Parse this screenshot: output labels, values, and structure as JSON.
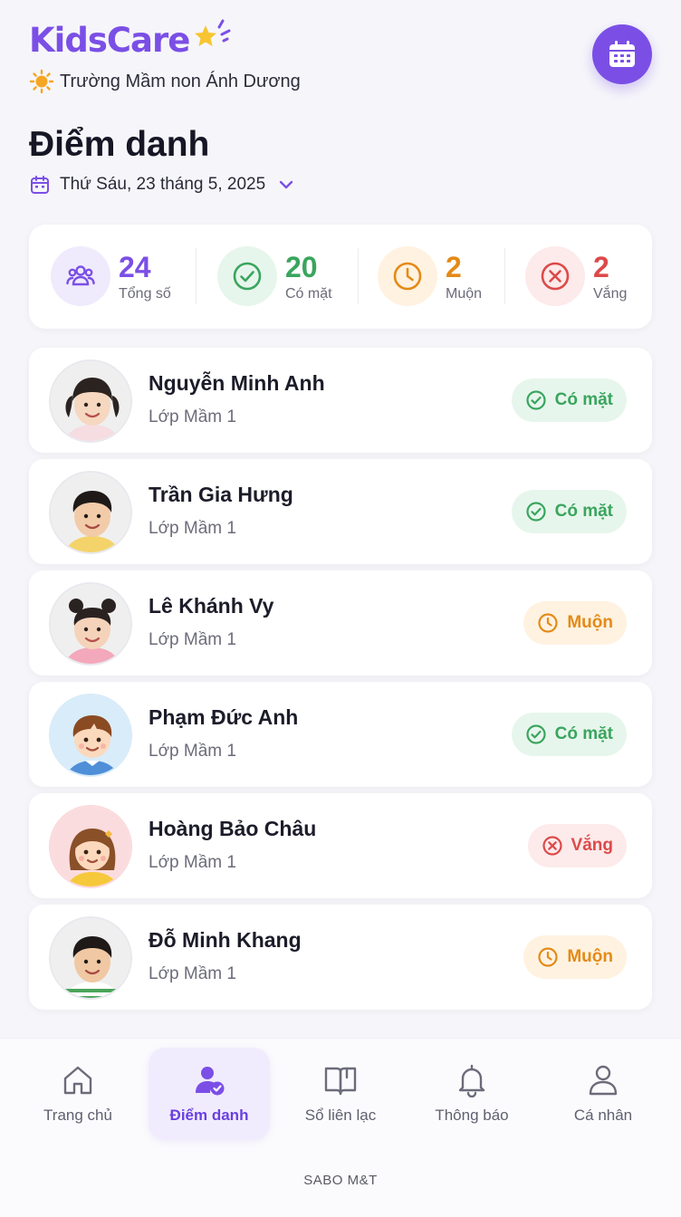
{
  "app": {
    "logo_text": "KidsCare",
    "school_name": "Trường Mầm non Ánh Dương"
  },
  "page": {
    "title": "Điểm danh",
    "date": "Thứ Sáu, 23 tháng 5, 2025"
  },
  "stats": [
    {
      "value": "24",
      "label": "Tổng số",
      "icon": "users-icon",
      "color": "#7b4fe6"
    },
    {
      "value": "20",
      "label": "Có mặt",
      "icon": "check-circle-icon",
      "color": "#3aa55e"
    },
    {
      "value": "2",
      "label": "Muộn",
      "icon": "clock-icon",
      "color": "#e48a17"
    },
    {
      "value": "2",
      "label": "Vắng",
      "icon": "x-circle-icon",
      "color": "#dc4a4a"
    }
  ],
  "students": [
    {
      "name": "Nguyễn Minh Anh",
      "class": "Lớp Mầm 1",
      "status": "Có mặt"
    },
    {
      "name": "Trần Gia Hưng",
      "class": "Lớp Mầm 1",
      "status": "Có mặt"
    },
    {
      "name": "Lê Khánh Vy",
      "class": "Lớp Mầm 1",
      "status": "Muộn"
    },
    {
      "name": "Phạm Đức Anh",
      "class": "Lớp Mầm 1",
      "status": "Có mặt"
    },
    {
      "name": "Hoàng Bảo Châu",
      "class": "Lớp Mầm 1",
      "status": "Vắng"
    },
    {
      "name": "Đỗ Minh Khang",
      "class": "Lớp Mầm 1",
      "status": "Muộn"
    }
  ],
  "nav": [
    {
      "label": "Trang chủ",
      "icon": "home-icon"
    },
    {
      "label": "Điểm danh",
      "icon": "user-check-icon"
    },
    {
      "label": "Sổ liên lạc",
      "icon": "book-icon"
    },
    {
      "label": "Thông báo",
      "icon": "bell-icon"
    },
    {
      "label": "Cá nhân",
      "icon": "user-icon"
    }
  ],
  "footer": "SABO M&T",
  "colors": {
    "brand": "#7b4fe6",
    "present": "#3aa55e",
    "late": "#e48a17",
    "absent": "#dc4a4a"
  }
}
